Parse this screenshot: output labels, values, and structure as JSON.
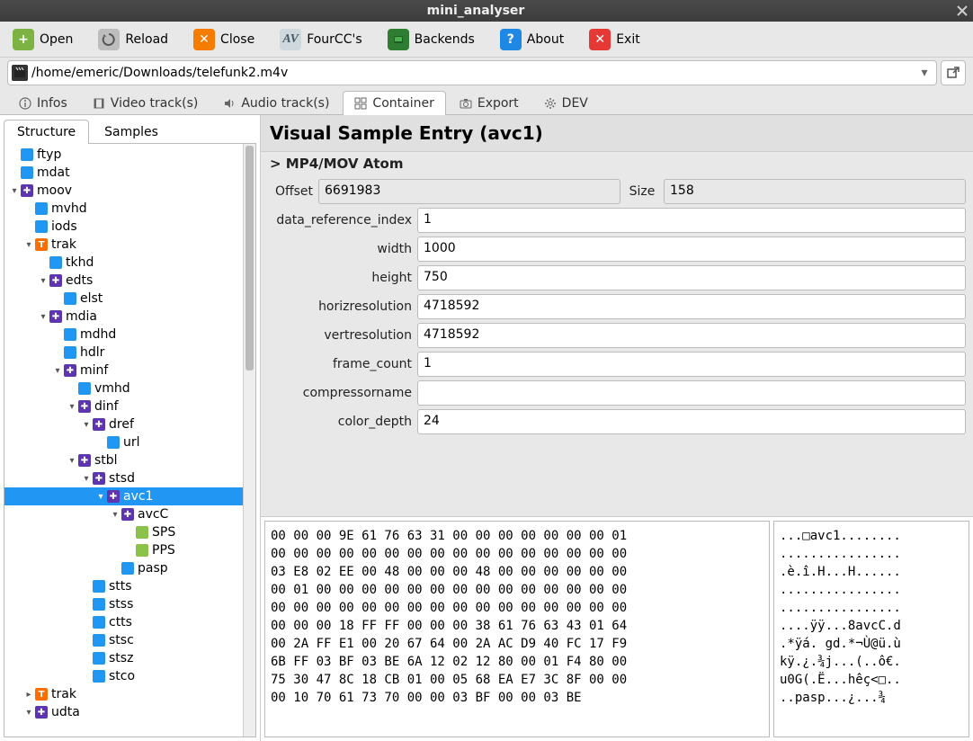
{
  "window": {
    "title": "mini_analyser"
  },
  "toolbar": {
    "open": "Open",
    "reload": "Reload",
    "close": "Close",
    "fourcc": "FourCC's",
    "backends": "Backends",
    "about": "About",
    "exit": "Exit"
  },
  "path": "/home/emeric/Downloads/telefunk2.m4v",
  "maintabs": {
    "infos": "Infos",
    "video": "Video track(s)",
    "audio": "Audio track(s)",
    "container": "Container",
    "export": "Export",
    "dev": "DEV"
  },
  "lefttabs": {
    "structure": "Structure",
    "samples": "Samples"
  },
  "tree": [
    {
      "d": 0,
      "exp": "",
      "ic": "blue",
      "lbl": "ftyp"
    },
    {
      "d": 0,
      "exp": "",
      "ic": "blue",
      "lbl": "mdat"
    },
    {
      "d": 0,
      "exp": "v",
      "ic": "plus",
      "lbl": "moov"
    },
    {
      "d": 1,
      "exp": "",
      "ic": "blue",
      "lbl": "mvhd"
    },
    {
      "d": 1,
      "exp": "",
      "ic": "blue",
      "lbl": "iods"
    },
    {
      "d": 1,
      "exp": "v",
      "ic": "t",
      "lbl": "trak"
    },
    {
      "d": 2,
      "exp": "",
      "ic": "blue",
      "lbl": "tkhd"
    },
    {
      "d": 2,
      "exp": "v",
      "ic": "plus",
      "lbl": "edts"
    },
    {
      "d": 3,
      "exp": "",
      "ic": "blue",
      "lbl": "elst"
    },
    {
      "d": 2,
      "exp": "v",
      "ic": "plus",
      "lbl": "mdia"
    },
    {
      "d": 3,
      "exp": "",
      "ic": "blue",
      "lbl": "mdhd"
    },
    {
      "d": 3,
      "exp": "",
      "ic": "blue",
      "lbl": "hdlr"
    },
    {
      "d": 3,
      "exp": "v",
      "ic": "plus",
      "lbl": "minf"
    },
    {
      "d": 4,
      "exp": "",
      "ic": "blue",
      "lbl": "vmhd"
    },
    {
      "d": 4,
      "exp": "v",
      "ic": "plus",
      "lbl": "dinf"
    },
    {
      "d": 5,
      "exp": "v",
      "ic": "plus",
      "lbl": "dref"
    },
    {
      "d": 6,
      "exp": "",
      "ic": "blue",
      "lbl": "url"
    },
    {
      "d": 4,
      "exp": "v",
      "ic": "plus",
      "lbl": "stbl"
    },
    {
      "d": 5,
      "exp": "v",
      "ic": "plus",
      "lbl": "stsd"
    },
    {
      "d": 6,
      "exp": "v",
      "ic": "plus",
      "lbl": "avc1",
      "sel": true
    },
    {
      "d": 7,
      "exp": "v",
      "ic": "plus",
      "lbl": "avcC"
    },
    {
      "d": 8,
      "exp": "",
      "ic": "green",
      "lbl": "SPS"
    },
    {
      "d": 8,
      "exp": "",
      "ic": "green",
      "lbl": "PPS"
    },
    {
      "d": 7,
      "exp": "",
      "ic": "blue",
      "lbl": "pasp"
    },
    {
      "d": 5,
      "exp": "",
      "ic": "blue",
      "lbl": "stts"
    },
    {
      "d": 5,
      "exp": "",
      "ic": "blue",
      "lbl": "stss"
    },
    {
      "d": 5,
      "exp": "",
      "ic": "blue",
      "lbl": "ctts"
    },
    {
      "d": 5,
      "exp": "",
      "ic": "blue",
      "lbl": "stsc"
    },
    {
      "d": 5,
      "exp": "",
      "ic": "blue",
      "lbl": "stsz"
    },
    {
      "d": 5,
      "exp": "",
      "ic": "blue",
      "lbl": "stco"
    },
    {
      "d": 1,
      "exp": ">",
      "ic": "t",
      "lbl": "trak"
    },
    {
      "d": 1,
      "exp": "v",
      "ic": "plus",
      "lbl": "udta"
    }
  ],
  "detail": {
    "title": "Visual Sample Entry (avc1)",
    "subtitle": "> MP4/MOV Atom",
    "offset_lbl": "Offset",
    "offset": "6691983",
    "size_lbl": "Size",
    "size": "158",
    "fields": [
      {
        "label": "data_reference_index",
        "value": "1"
      },
      {
        "label": "width",
        "value": "1000"
      },
      {
        "label": "height",
        "value": "750"
      },
      {
        "label": "horizresolution",
        "value": "4718592"
      },
      {
        "label": "vertresolution",
        "value": "4718592"
      },
      {
        "label": "frame_count",
        "value": "1"
      },
      {
        "label": "compressorname",
        "value": ""
      },
      {
        "label": "color_depth",
        "value": "24"
      }
    ]
  },
  "hex": [
    "00 00 00 9E 61 76 63 31 00 00 00 00 00 00 00 01",
    "00 00 00 00 00 00 00 00 00 00 00 00 00 00 00 00",
    "03 E8 02 EE 00 48 00 00 00 48 00 00 00 00 00 00",
    "00 01 00 00 00 00 00 00 00 00 00 00 00 00 00 00",
    "00 00 00 00 00 00 00 00 00 00 00 00 00 00 00 00",
    "00 00 00 18 FF FF 00 00 00 38 61 76 63 43 01 64",
    "00 2A FF E1 00 20 67 64 00 2A AC D9 40 FC 17 F9",
    "6B FF 03 BF 03 BE 6A 12 02 12 80 00 01 F4 80 00",
    "75 30 47 8C 18 CB 01 00 05 68 EA E7 3C 8F 00 00",
    "00 10 70 61 73 70 00 00 03 BF 00 00 03 BE"
  ],
  "ascii": [
    "...□avc1........",
    "................",
    ".è.î.H...H......",
    "................",
    "................",
    "....ÿÿ...8avcC.d",
    ".*ÿá. gd.*¬Ù@ü.ù",
    "kÿ.¿.¾j...(..ô€.",
    "u0G(.Ë...hêç<□..",
    "..pasp...¿...¾"
  ]
}
